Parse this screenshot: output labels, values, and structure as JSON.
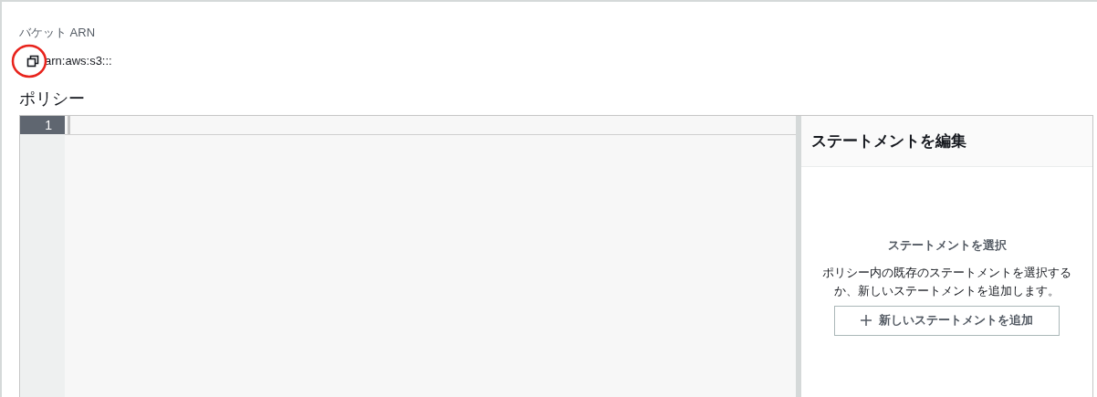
{
  "bucket_arn": {
    "label": "バケット ARN",
    "value": "arn:aws:s3:::"
  },
  "policy": {
    "heading": "ポリシー",
    "editor": {
      "lines": [
        {
          "number": "1",
          "selected": true
        }
      ]
    }
  },
  "statement_panel": {
    "title": "ステートメントを編集",
    "empty_title": "ステートメントを選択",
    "empty_text": "ポリシー内の既存のステートメントを選択するか、新しいステートメントを追加します。",
    "add_button": "新しいステートメントを追加"
  }
}
